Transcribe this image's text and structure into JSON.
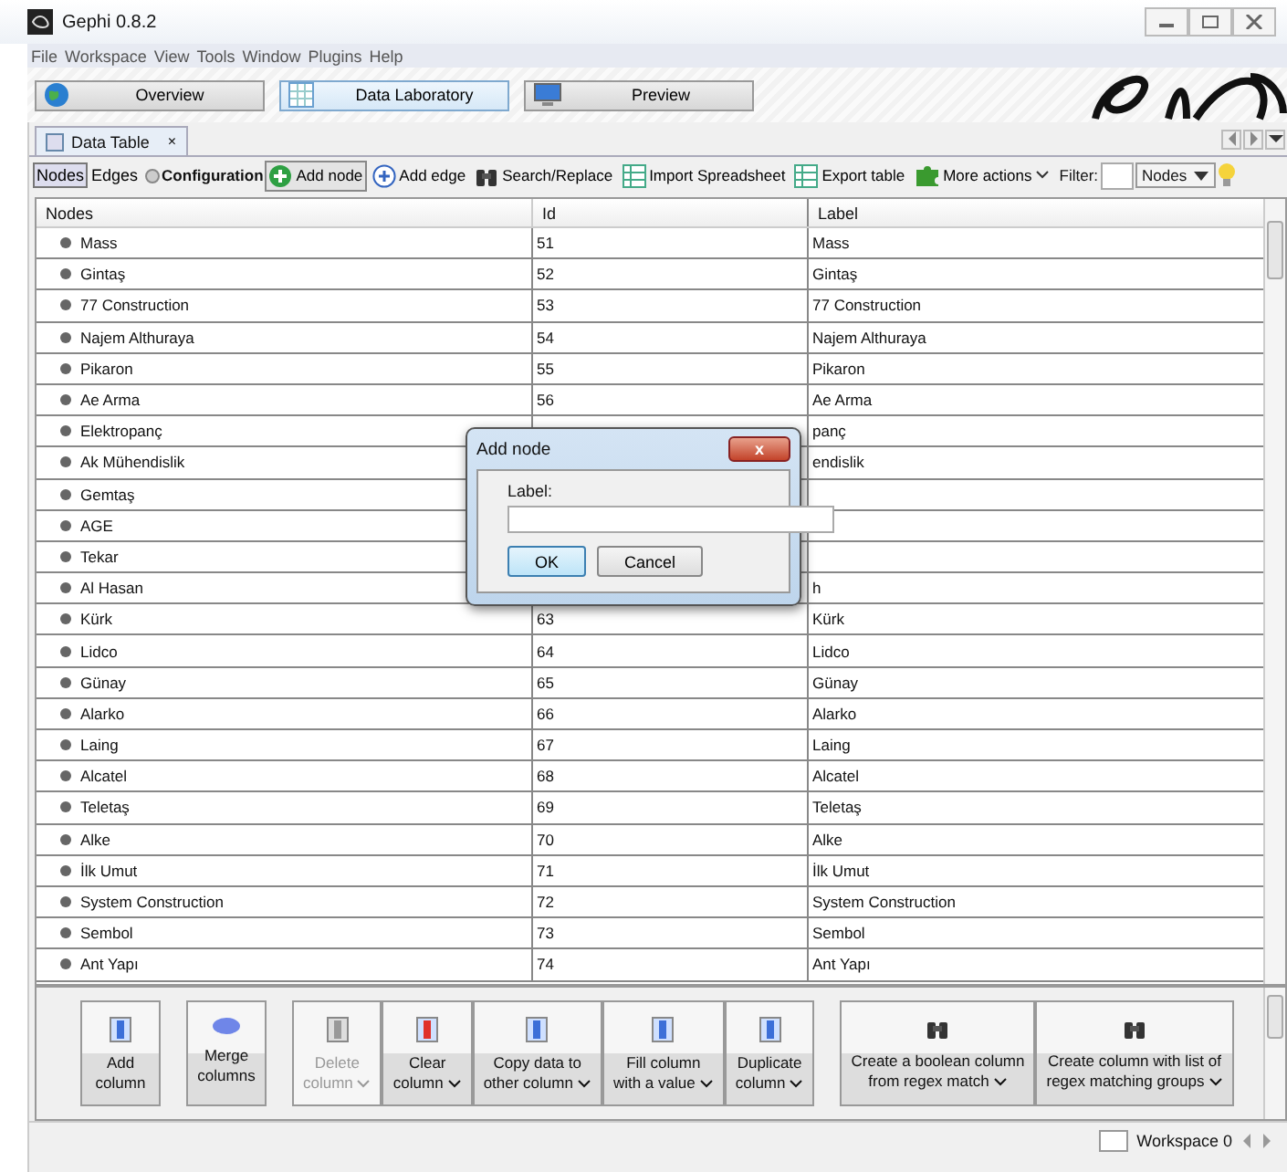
{
  "window": {
    "title": "Gephi 0.8.2"
  },
  "menu": [
    "File",
    "Workspace",
    "View",
    "Tools",
    "Window",
    "Plugins",
    "Help"
  ],
  "perspectives": [
    {
      "label": "Overview",
      "kind": "globe",
      "selected": false
    },
    {
      "label": "Data Laboratory",
      "kind": "table",
      "selected": true
    },
    {
      "label": "Preview",
      "kind": "monitor",
      "selected": false
    }
  ],
  "doc_tab": {
    "label": "Data Table",
    "close": "×"
  },
  "toolbar": {
    "view_toggle": [
      {
        "label": "Nodes",
        "selected": true
      },
      {
        "label": "Edges",
        "selected": false
      }
    ],
    "configuration": "Configuration",
    "actions": [
      {
        "label": "Add node",
        "kind": "add",
        "pressed": true,
        "dropdown": false
      },
      {
        "label": "Add edge",
        "kind": "plus",
        "pressed": false,
        "dropdown": false
      },
      {
        "label": "Search/Replace",
        "kind": "binoculars",
        "pressed": false,
        "dropdown": false
      },
      {
        "label": "Import Spreadsheet",
        "kind": "sheet",
        "pressed": false,
        "dropdown": false
      },
      {
        "label": "Export table",
        "kind": "sheet",
        "pressed": false,
        "dropdown": false
      },
      {
        "label": "More actions",
        "kind": "puzzle",
        "pressed": false,
        "dropdown": true
      }
    ],
    "filter_label": "Filter:",
    "filter_target": "Nodes"
  },
  "table": {
    "columns": [
      "Nodes",
      "Id",
      "Label"
    ],
    "rows": [
      {
        "name": "Mass",
        "id": "51",
        "label": "Mass"
      },
      {
        "name": "Gintaş",
        "id": "52",
        "label": "Gintaş"
      },
      {
        "name": "77 Construction",
        "id": "53",
        "label": "77 Construction"
      },
      {
        "name": "Najem Althuraya",
        "id": "54",
        "label": "Najem Althuraya"
      },
      {
        "name": "Pikaron",
        "id": "55",
        "label": "Pikaron"
      },
      {
        "name": "Ae Arma",
        "id": "56",
        "label": "Ae Arma"
      },
      {
        "name": "Elektropanç",
        "label": "panç"
      },
      {
        "name": "Ak Mühendislik",
        "label": "endislik"
      },
      {
        "name": "Gemtaş"
      },
      {
        "name": "AGE"
      },
      {
        "name": "Tekar"
      },
      {
        "name": "Al Hasan",
        "label": "h"
      },
      {
        "name": "Kürk",
        "id": "63",
        "label": "Kürk"
      },
      {
        "name": "Lidco",
        "id": "64",
        "label": "Lidco"
      },
      {
        "name": "Günay",
        "id": "65",
        "label": "Günay"
      },
      {
        "name": "Alarko",
        "id": "66",
        "label": "Alarko"
      },
      {
        "name": "Laing",
        "id": "67",
        "label": "Laing"
      },
      {
        "name": "Alcatel",
        "id": "68",
        "label": "Alcatel"
      },
      {
        "name": "Teletaş",
        "id": "69",
        "label": "Teletaş"
      },
      {
        "name": "Alke",
        "id": "70",
        "label": "Alke"
      },
      {
        "name": "İlk Umut",
        "id": "71",
        "label": "İlk Umut"
      },
      {
        "name": "System Construction",
        "id": "72",
        "label": "System Construction"
      },
      {
        "name": "Sembol",
        "id": "73",
        "label": "Sembol"
      },
      {
        "name": "Ant Yapı",
        "id": "74",
        "label": "Ant Yapı"
      }
    ]
  },
  "dialog": {
    "title": "Add node",
    "close": "x",
    "field_label": "Label:",
    "buttons": [
      {
        "label": "OK",
        "default": true
      },
      {
        "label": "Cancel",
        "default": false
      }
    ]
  },
  "column_groups": [
    [
      {
        "lines": [
          "Add",
          "column"
        ],
        "kind": "column",
        "disabled": false,
        "dropdown": false
      }
    ],
    [
      {
        "lines": [
          "Merge",
          "columns"
        ],
        "kind": "merge",
        "disabled": false,
        "dropdown": false
      }
    ],
    [
      {
        "lines": [
          "Delete",
          "column"
        ],
        "kind": "column",
        "disabled": true,
        "dropdown": true
      },
      {
        "lines": [
          "Clear",
          "column"
        ],
        "kind": "clear",
        "disabled": false,
        "dropdown": true
      },
      {
        "lines": [
          "Copy data to",
          "other column"
        ],
        "kind": "column",
        "disabled": false,
        "dropdown": true
      },
      {
        "lines": [
          "Fill column",
          "with a value"
        ],
        "kind": "column",
        "disabled": false,
        "dropdown": true
      },
      {
        "lines": [
          "Duplicate",
          "column"
        ],
        "kind": "column",
        "disabled": false,
        "dropdown": true
      }
    ],
    [
      {
        "lines": [
          "Create a boolean column",
          "from regex match"
        ],
        "kind": "binoculars",
        "disabled": false,
        "dropdown": true
      },
      {
        "lines": [
          "Create column with list of",
          "regex matching groups"
        ],
        "kind": "binoculars",
        "disabled": false,
        "dropdown": true
      }
    ]
  ],
  "status_bar": {
    "workspace": "Workspace 0"
  }
}
